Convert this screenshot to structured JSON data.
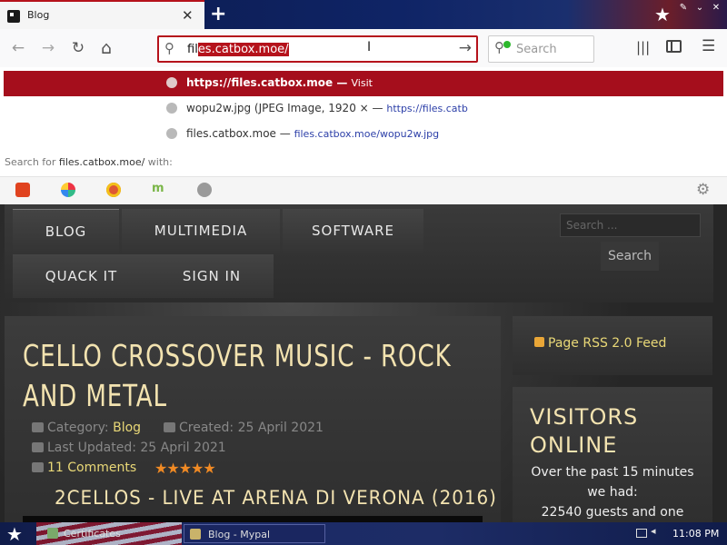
{
  "browser": {
    "tab": {
      "title": "Blog",
      "close_glyph": "✕"
    },
    "new_tab_glyph": "+",
    "window_controls": [
      "✎",
      "⌄",
      "✕"
    ],
    "url_bar": {
      "typed": "fil",
      "autofill": "es.catbox.moe/",
      "go_glyph": "→"
    },
    "search_placeholder": "Search",
    "menu_glyph": "☰",
    "library_glyph": "|||"
  },
  "nav_glyphs": {
    "back": "←",
    "forward": "→",
    "reload": "↻",
    "home": "⌂"
  },
  "suggestions": [
    {
      "text": "https://files.catbox.moe",
      "sep": " — ",
      "action": "Visit"
    },
    {
      "text": "wopu2w.jpg (JPEG Image, 1920 ×",
      "sep": " — ",
      "url": "https://files.catb"
    },
    {
      "text": "files.catbox.moe",
      "sep": " — ",
      "url": "files.catbox.moe/wopu2w.jpg"
    }
  ],
  "search_for": {
    "prefix": "Search for ",
    "query": "files.catbox.moe/",
    "suffix": " with:"
  },
  "engines": [
    {
      "name": "brave-icon",
      "color": "#e0431f"
    },
    {
      "name": "qwant-icon",
      "color": "#3d8be0"
    },
    {
      "name": "duckduckgo-icon",
      "color": "#de5833"
    },
    {
      "name": "mojeek-icon",
      "color": "#7ab648"
    },
    {
      "name": "search-engine-icon",
      "color": "#9a9a9a"
    }
  ],
  "site": {
    "menu": [
      "BLOG",
      "MULTIMEDIA",
      "SOFTWARE",
      "QUACK IT",
      "SIGN IN"
    ],
    "search_placeholder": "Search ...",
    "search_button": "Search",
    "article": {
      "title": "CELLO CROSSOVER MUSIC - ROCK AND METAL",
      "category_label": "Category: ",
      "category": "Blog",
      "created": "Created: 25 April 2021",
      "updated": "Last Updated: 25 April 2021",
      "comments": "11 Comments",
      "rating_stars": "★★★★★",
      "video_title": "2CELLOS - LIVE AT ARENA DI VERONA (2016)"
    },
    "rss": "Page RSS 2.0 Feed",
    "visitors": {
      "title": "VISITORS ONLINE",
      "lines": [
        "Over the past 15 minutes",
        "we had:",
        "22540 guests and one"
      ]
    }
  },
  "taskbar": {
    "tasks": [
      "Certificates",
      "Blog - Mypal"
    ],
    "clock": "11:08 PM"
  }
}
